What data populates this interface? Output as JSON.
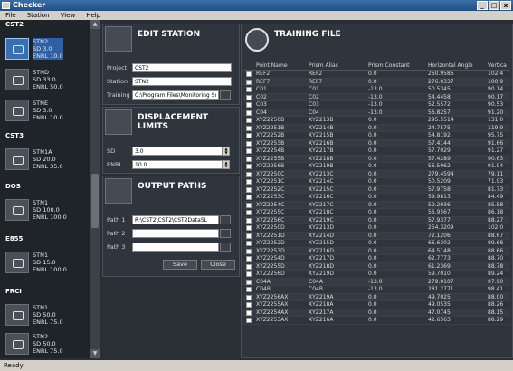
{
  "window": {
    "title": "Checker",
    "min": "_",
    "max": "□",
    "close": "x"
  },
  "menu": [
    "File",
    "Station",
    "View",
    "Help"
  ],
  "stations": {
    "groups": [
      {
        "label": "CST2",
        "items": [
          {
            "name": "STN2",
            "sd": "SD 3.0",
            "enrl": "ENRL 10.0",
            "selected": true
          },
          {
            "name": "STND",
            "sd": "SD 33.0",
            "enrl": "ENRL 50.0"
          },
          {
            "name": "STNE",
            "sd": "SD 3.0",
            "enrl": "ENRL 10.0"
          }
        ]
      },
      {
        "label": "CST3",
        "items": [
          {
            "name": "STN1A",
            "sd": "SD 20.0",
            "enrl": "ENRL 35.0"
          }
        ]
      },
      {
        "label": "DOS",
        "items": [
          {
            "name": "STN1",
            "sd": "SD 100.0",
            "enrl": "ENRL 100.0"
          }
        ]
      },
      {
        "label": "E855",
        "items": [
          {
            "name": "STN1",
            "sd": "SD 15.0",
            "enrl": "ENRL 100.0"
          }
        ]
      },
      {
        "label": "FRCI",
        "items": [
          {
            "name": "STN1",
            "sd": "SD 50.0",
            "enrl": "ENRL 75.0"
          },
          {
            "name": "STN2",
            "sd": "SD 50.0",
            "enrl": "ENRL 75.0"
          }
        ]
      }
    ]
  },
  "edit_station": {
    "title": "EDIT STATION",
    "project_label": "Project",
    "project_value": "CST2",
    "station_label": "Station",
    "station_value": "STN2",
    "training_label": "Training",
    "training_value": "C:\\Program Files\\Monitoring Solutio"
  },
  "displacement": {
    "title": "DISPLACEMENT LIMITS",
    "sd_label": "SD",
    "sd_value": "3.0",
    "enrl_label": "ENRL",
    "enrl_value": "10.0"
  },
  "output_paths": {
    "title": "OUTPUT PATHS",
    "path1_label": "Path 1",
    "path1_value": "R:\\CST2\\CST2\\CST2DataSL",
    "path2_label": "Path 2",
    "path2_value": "",
    "path3_label": "Path 3",
    "path3_value": "",
    "save_label": "Save",
    "close_label": "Close"
  },
  "training_file": {
    "title": "TRAINING FILE",
    "columns": [
      "Point Name",
      "Prism Alias",
      "Prism Constant",
      "Horizontal Angle",
      "Vertica"
    ],
    "rows": [
      [
        "REF2",
        "REF2",
        "0.0",
        "260.9586",
        "102.4"
      ],
      [
        "REF7",
        "REF7",
        "0.0",
        "276.0337",
        "100.9"
      ],
      [
        "C01",
        "C01",
        "-13.0",
        "50.5345",
        "90.14"
      ],
      [
        "C02",
        "C02",
        "-13.0",
        "54.4458",
        "90.17"
      ],
      [
        "C03",
        "C03",
        "-13.0",
        "52.5572",
        "90.53"
      ],
      [
        "C04",
        "C04",
        "-13.0",
        "56.8257",
        "91.20"
      ],
      [
        "XYZ2250B",
        "XYZ213B",
        "0.0",
        "295.5514",
        "131.0"
      ],
      [
        "XYZ2251B",
        "XYZ214B",
        "0.0",
        "24.7575",
        "119.9"
      ],
      [
        "XYZ2252B",
        "XYZ215B",
        "0.0",
        "54.8192",
        "95.75"
      ],
      [
        "XYZ2253B",
        "XYZ216B",
        "0.0",
        "57.4144",
        "91.66"
      ],
      [
        "XYZ2254B",
        "XYZ217B",
        "0.0",
        "57.7029",
        "91.27"
      ],
      [
        "XYZ2255B",
        "XYZ218B",
        "0.0",
        "57.4289",
        "90.63"
      ],
      [
        "XYZ2256B",
        "XYZ219B",
        "0.0",
        "56.5962",
        "91.94"
      ],
      [
        "XYZ2250C",
        "XYZ213C",
        "0.0",
        "279.4594",
        "79.11"
      ],
      [
        "XYZ2251C",
        "XYZ214C",
        "0.0",
        "50.5209",
        "71.93"
      ],
      [
        "XYZ2252C",
        "XYZ215C",
        "0.0",
        "57.9758",
        "81.73"
      ],
      [
        "XYZ2253C",
        "XYZ216C",
        "0.0",
        "59.9813",
        "84.49"
      ],
      [
        "XYZ2254C",
        "XYZ217C",
        "0.0",
        "59.2936",
        "85.58"
      ],
      [
        "XYZ2255C",
        "XYZ218C",
        "0.0",
        "56.9567",
        "86.18"
      ],
      [
        "XYZ2256C",
        "XYZ219C",
        "0.0",
        "57.9377",
        "88.27"
      ],
      [
        "XYZ2250D",
        "XYZ213D",
        "0.0",
        "254.3209",
        "102.0"
      ],
      [
        "XYZ2251D",
        "XYZ214D",
        "0.0",
        "72.1206",
        "88.67"
      ],
      [
        "XYZ2252D",
        "XYZ215D",
        "0.0",
        "66.6302",
        "89.68"
      ],
      [
        "XYZ2253D",
        "XYZ216D",
        "0.0",
        "64.5148",
        "88.66"
      ],
      [
        "XYZ2254D",
        "XYZ217D",
        "0.0",
        "62.7773",
        "88.70"
      ],
      [
        "XYZ2255D",
        "XYZ218D",
        "0.0",
        "61.2369",
        "88.78"
      ],
      [
        "XYZ2256D",
        "XYZ219D",
        "0.0",
        "59.7010",
        "89.24"
      ],
      [
        "C04A",
        "C04A",
        "-13.0",
        "279.0107",
        "97.90"
      ],
      [
        "C04B",
        "C04B",
        "-13.0",
        "281.2771",
        "98.41"
      ],
      [
        "XYZ2256AX",
        "XYZ219A",
        "0.0",
        "49.7025",
        "88.00"
      ],
      [
        "XYZ2255AX",
        "XYZ218A",
        "0.0",
        "49.0535",
        "88.26"
      ],
      [
        "XYZ2254AX",
        "XYZ217A",
        "0.0",
        "47.0745",
        "88.15"
      ],
      [
        "XYZ2253AX",
        "XYZ216A",
        "0.0",
        "42.6563",
        "88.29"
      ]
    ]
  },
  "status": "Ready"
}
